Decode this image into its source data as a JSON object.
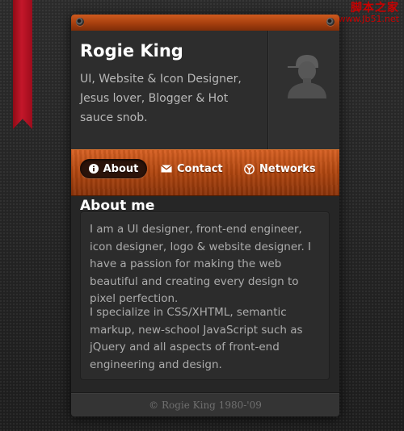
{
  "watermark": {
    "title": "脚本之家",
    "url": "www.Jb51.net"
  },
  "profile": {
    "name": "Rogie King",
    "bio": "UI, Website & Icon Designer, Jesus lover, Blogger & Hot sauce snob.",
    "avatar_icon": "user-silhouette-icon"
  },
  "nav": {
    "items": [
      {
        "label": "About",
        "icon": "info-icon",
        "active": true
      },
      {
        "label": "Contact",
        "icon": "envelope-icon",
        "active": false
      },
      {
        "label": "Networks",
        "icon": "globe-icon",
        "active": false
      }
    ]
  },
  "about": {
    "title": "About me",
    "paragraphs": [
      "I am a UI designer, front-end engineer, icon designer, logo & website designer. I have a passion for making the web beautiful and creating every design to pixel perfection.",
      "I specialize in CSS/XHTML, semantic markup, new-school JavaScript such as jQuery and all aspects of front-end engineering and design."
    ]
  },
  "footer": {
    "text": "© Rogie King 1980-'09"
  },
  "colors": {
    "accent": "#b4470f",
    "ribbon": "#c4172a",
    "background": "#1e1e1e"
  }
}
